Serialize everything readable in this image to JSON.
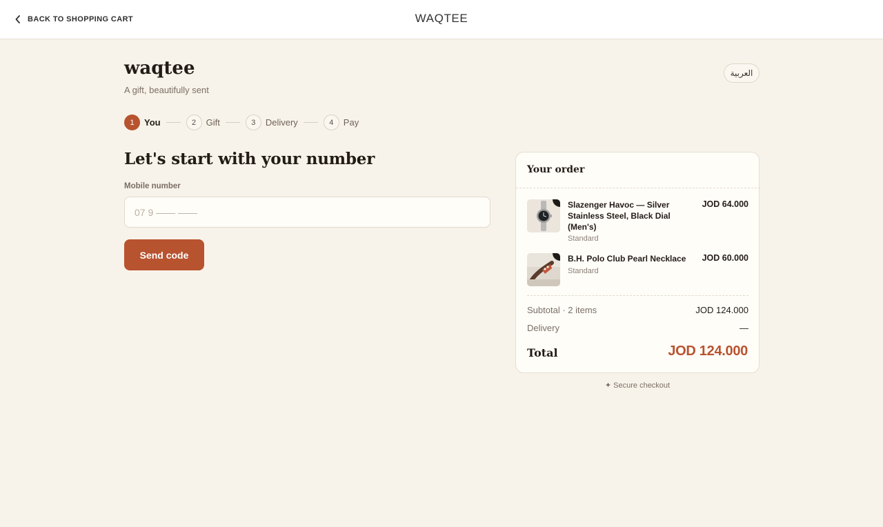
{
  "topbar": {
    "back_label": "BACK TO SHOPPING CART",
    "store_name": "WAQTEE"
  },
  "brand": {
    "name": "waqtee",
    "tagline": "A gift, beautifully sent"
  },
  "language_toggle": "العربية",
  "steps": [
    {
      "num": "1",
      "label": "You",
      "active": true
    },
    {
      "num": "2",
      "label": "Gift",
      "active": false
    },
    {
      "num": "3",
      "label": "Delivery",
      "active": false
    },
    {
      "num": "4",
      "label": "Pay",
      "active": false
    }
  ],
  "form": {
    "heading": "Let's start with your number",
    "mobile_label": "Mobile number",
    "mobile_placeholder": "07 9 —— ——",
    "mobile_value": "",
    "send_label": "Send code"
  },
  "order": {
    "title": "Your order",
    "items": [
      {
        "name": "Slazenger Havoc — Silver Stainless Steel, Black Dial (Men's)",
        "variant": "Standard",
        "price": "JOD 64.000",
        "image": "watch-image"
      },
      {
        "name": "B.H. Polo Club Pearl Necklace",
        "variant": "Standard",
        "price": "JOD 60.000",
        "image": "necklace-image"
      }
    ],
    "subtotal_label": "Subtotal · 2 items",
    "subtotal_value": "JOD 124.000",
    "delivery_label": "Delivery",
    "delivery_value": "—",
    "total_label": "Total",
    "total_value": "JOD 124.000"
  },
  "secure_text": "✦ Secure checkout",
  "colors": {
    "accent": "#b8532f",
    "background": "#f8f3ea",
    "card": "#fffdf8"
  }
}
